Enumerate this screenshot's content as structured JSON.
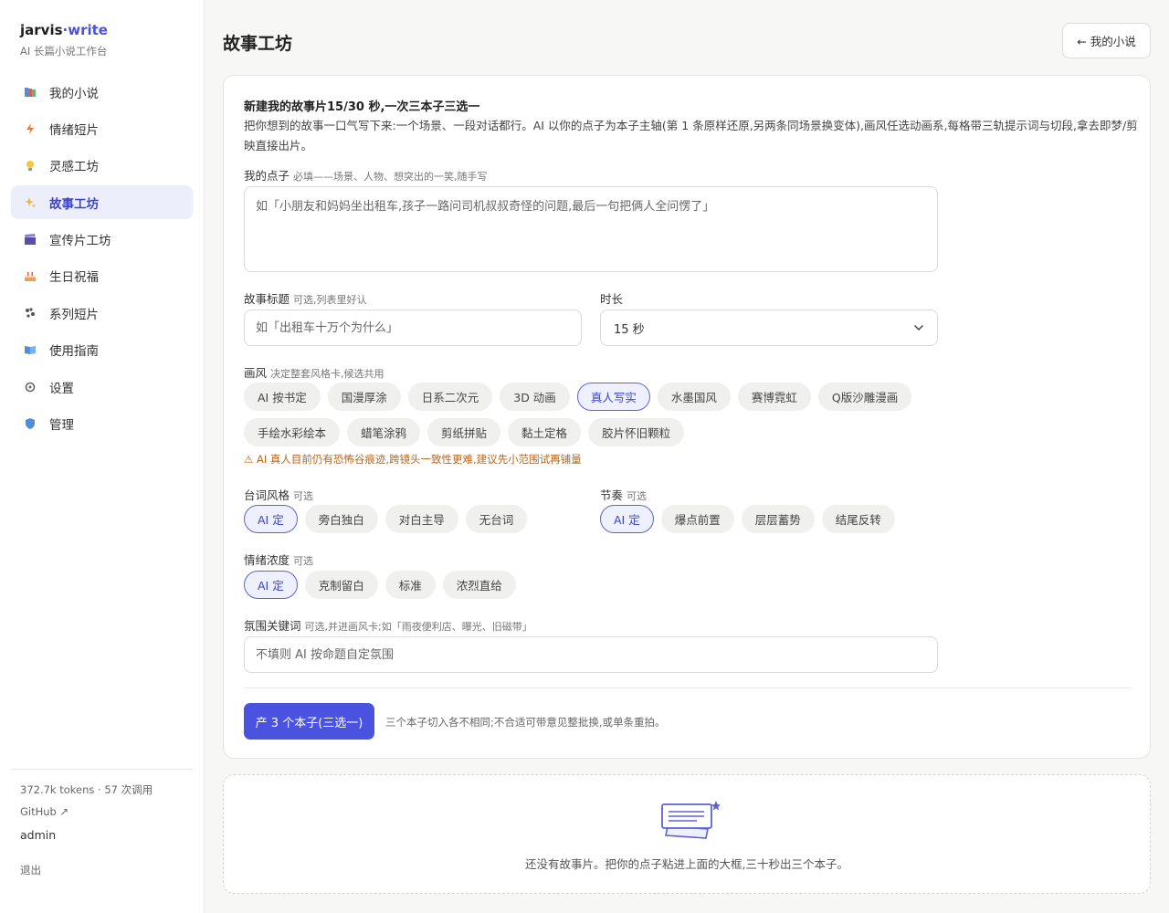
{
  "brand": {
    "name_main": "jarvis",
    "name_accent": "·write",
    "subtitle": "AI 长篇小说工作台"
  },
  "sidebar": {
    "items": [
      {
        "label": "我的小说",
        "icon": "books-icon"
      },
      {
        "label": "情绪短片",
        "icon": "lightning-icon"
      },
      {
        "label": "灵感工坊",
        "icon": "lightbulb-icon"
      },
      {
        "label": "故事工坊",
        "icon": "sparkles-icon",
        "active": true
      },
      {
        "label": "宣传片工坊",
        "icon": "clapperboard-icon"
      },
      {
        "label": "生日祝福",
        "icon": "birthday-cake-icon"
      },
      {
        "label": "系列短片",
        "icon": "paw-prints-icon"
      },
      {
        "label": "使用指南",
        "icon": "open-book-icon"
      },
      {
        "label": "设置",
        "icon": "gear-icon"
      },
      {
        "label": "管理",
        "icon": "shield-icon"
      }
    ],
    "footer": {
      "usage": "372.7k tokens · 57 次调用",
      "github": "GitHub ↗",
      "user": "admin",
      "logout": "退出"
    }
  },
  "header": {
    "title": "故事工坊",
    "back_label": "← 我的小说"
  },
  "form": {
    "heading": "新建我的故事片15/30 秒,一次三本子三选一",
    "description": "把你想到的故事一口气写下来:一个场景、一段对话都行。AI 以你的点子为本子主轴(第 1 条原样还原,另两条同场景换变体),画风任选动画系,每格带三轨提示词与切段,拿去即梦/剪映直接出片。",
    "idea": {
      "label": "我的点子",
      "hint": "必填——场景、人物、想突出的一笑,随手写",
      "placeholder": "如「小朋友和妈妈坐出租车,孩子一路问司机叔叔奇怪的问题,最后一句把俩人全问愣了」"
    },
    "title_field": {
      "label": "故事标题",
      "hint": "可选,列表里好认",
      "placeholder": "如「出租车十万个为什么」"
    },
    "duration": {
      "label": "时长",
      "value": "15 秒"
    },
    "style": {
      "label": "画风",
      "hint": "决定整套风格卡,候选共用",
      "row1": [
        "AI 按书定",
        "国漫厚涂",
        "日系二次元",
        "3D 动画",
        "真人写实",
        "水墨国风",
        "赛博霓虹",
        "Q版沙雕漫画"
      ],
      "row2": [
        "手绘水彩绘本",
        "蜡笔涂鸦",
        "剪纸拼贴",
        "黏土定格",
        "胶片怀旧颗粒"
      ],
      "selected": "真人写实",
      "warning": "⚠ AI 真人目前仍有恐怖谷痕迹,跨镜头一致性更难,建议先小范围试再铺量"
    },
    "dialogue": {
      "label": "台词风格",
      "hint": "可选",
      "options": [
        "AI 定",
        "旁白独白",
        "对白主导",
        "无台词"
      ],
      "selected": "AI 定"
    },
    "rhythm": {
      "label": "节奏",
      "hint": "可选",
      "options": [
        "AI 定",
        "爆点前置",
        "层层蓄势",
        "结尾反转"
      ],
      "selected": "AI 定"
    },
    "intensity": {
      "label": "情绪浓度",
      "hint": "可选",
      "options": [
        "AI 定",
        "克制留白",
        "标准",
        "浓烈直给"
      ],
      "selected": "AI 定"
    },
    "atmosphere": {
      "label": "氛围关键词",
      "hint": "可选,并进画风卡;如「雨夜便利店、曝光、旧磁带」",
      "placeholder": "不填则 AI 按命题自定氛围"
    },
    "submit_label": "产 3 个本子(三选一)",
    "submit_note": "三个本子切入各不相同;不合适可带意见整批换,或单条重拍。"
  },
  "empty_state": {
    "icon": "script-pages-icon",
    "text": "还没有故事片。把你的点子粘进上面的大框,三十秒出三个本子。"
  },
  "colors": {
    "accent": "#4a52e0",
    "active_bg": "#eceefb",
    "warning": "#b8661a"
  }
}
